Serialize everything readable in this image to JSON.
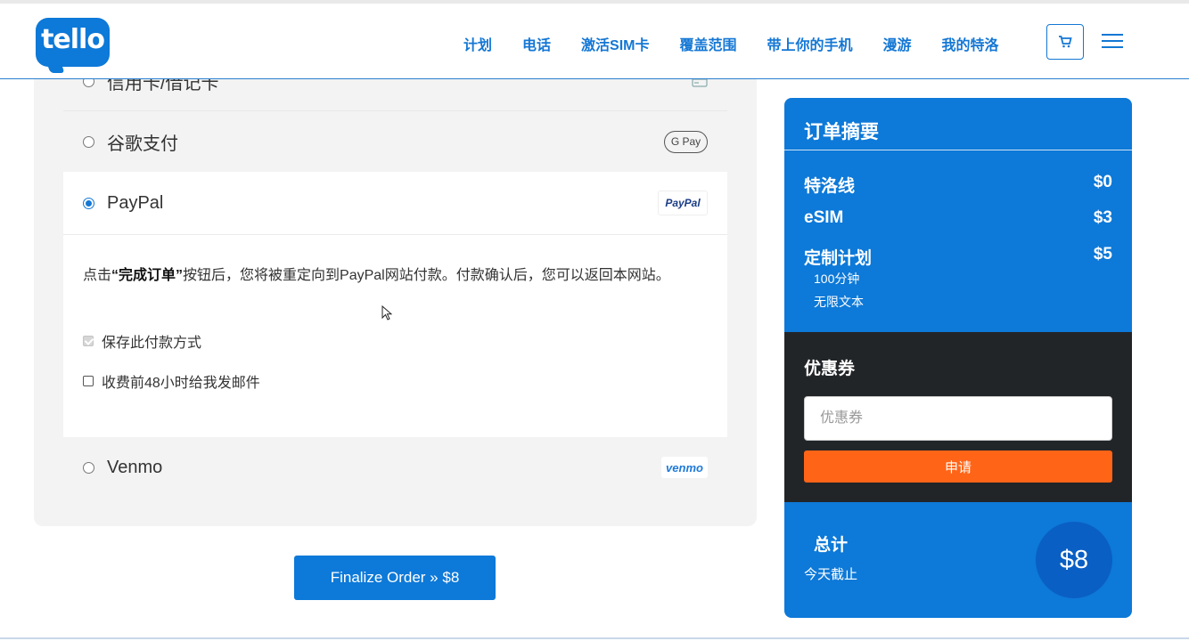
{
  "header": {
    "logo_text": "tello",
    "nav": [
      "计划",
      "电话",
      "激活SIM卡",
      "覆盖范围",
      "带上你的手机",
      "漫游",
      "我的特洛"
    ],
    "icons": {
      "cart": "cart-icon",
      "menu": "hamburger-menu-icon"
    },
    "brand_color": "#0d79d8"
  },
  "payment": {
    "methods": [
      {
        "label": "信用卡/借记卡",
        "selected": false,
        "logo_icon": "credit-card-icon"
      },
      {
        "label": "谷歌支付",
        "selected": false,
        "logo_text": "G Pay"
      },
      {
        "label": "PayPal",
        "selected": true,
        "logo_text": "PayPal"
      },
      {
        "label": "Venmo",
        "selected": false,
        "logo_text": "venmo"
      }
    ],
    "paypal_desc_prefix": "点击",
    "paypal_desc_bold": "“完成订单”",
    "paypal_desc_suffix": "按钮后，您将被重定向到PayPal网站付款。付款确认后，您可以返回本网站。",
    "save_method_label": "保存此付款方式",
    "save_method_checked": true,
    "email_reminder_label": "收费前48小时给我发邮件",
    "email_reminder_checked": false
  },
  "finalize_button": "Finalize Order » $8",
  "summary": {
    "title": "订单摘要",
    "lines": [
      {
        "label": "特洛线",
        "price": "$0"
      },
      {
        "label": "eSIM",
        "price": "$3"
      },
      {
        "label": "定制计划",
        "price": "$5"
      }
    ],
    "plan_details": [
      "100分钟",
      "无限文本"
    ],
    "coupon_title": "优惠券",
    "coupon_placeholder": "优惠券",
    "apply_button": "申请",
    "total_label": "总计",
    "total_sub": "今天截止",
    "total_value": "$8",
    "accent_orange": "#ff6417",
    "dark_bg": "#222528"
  }
}
